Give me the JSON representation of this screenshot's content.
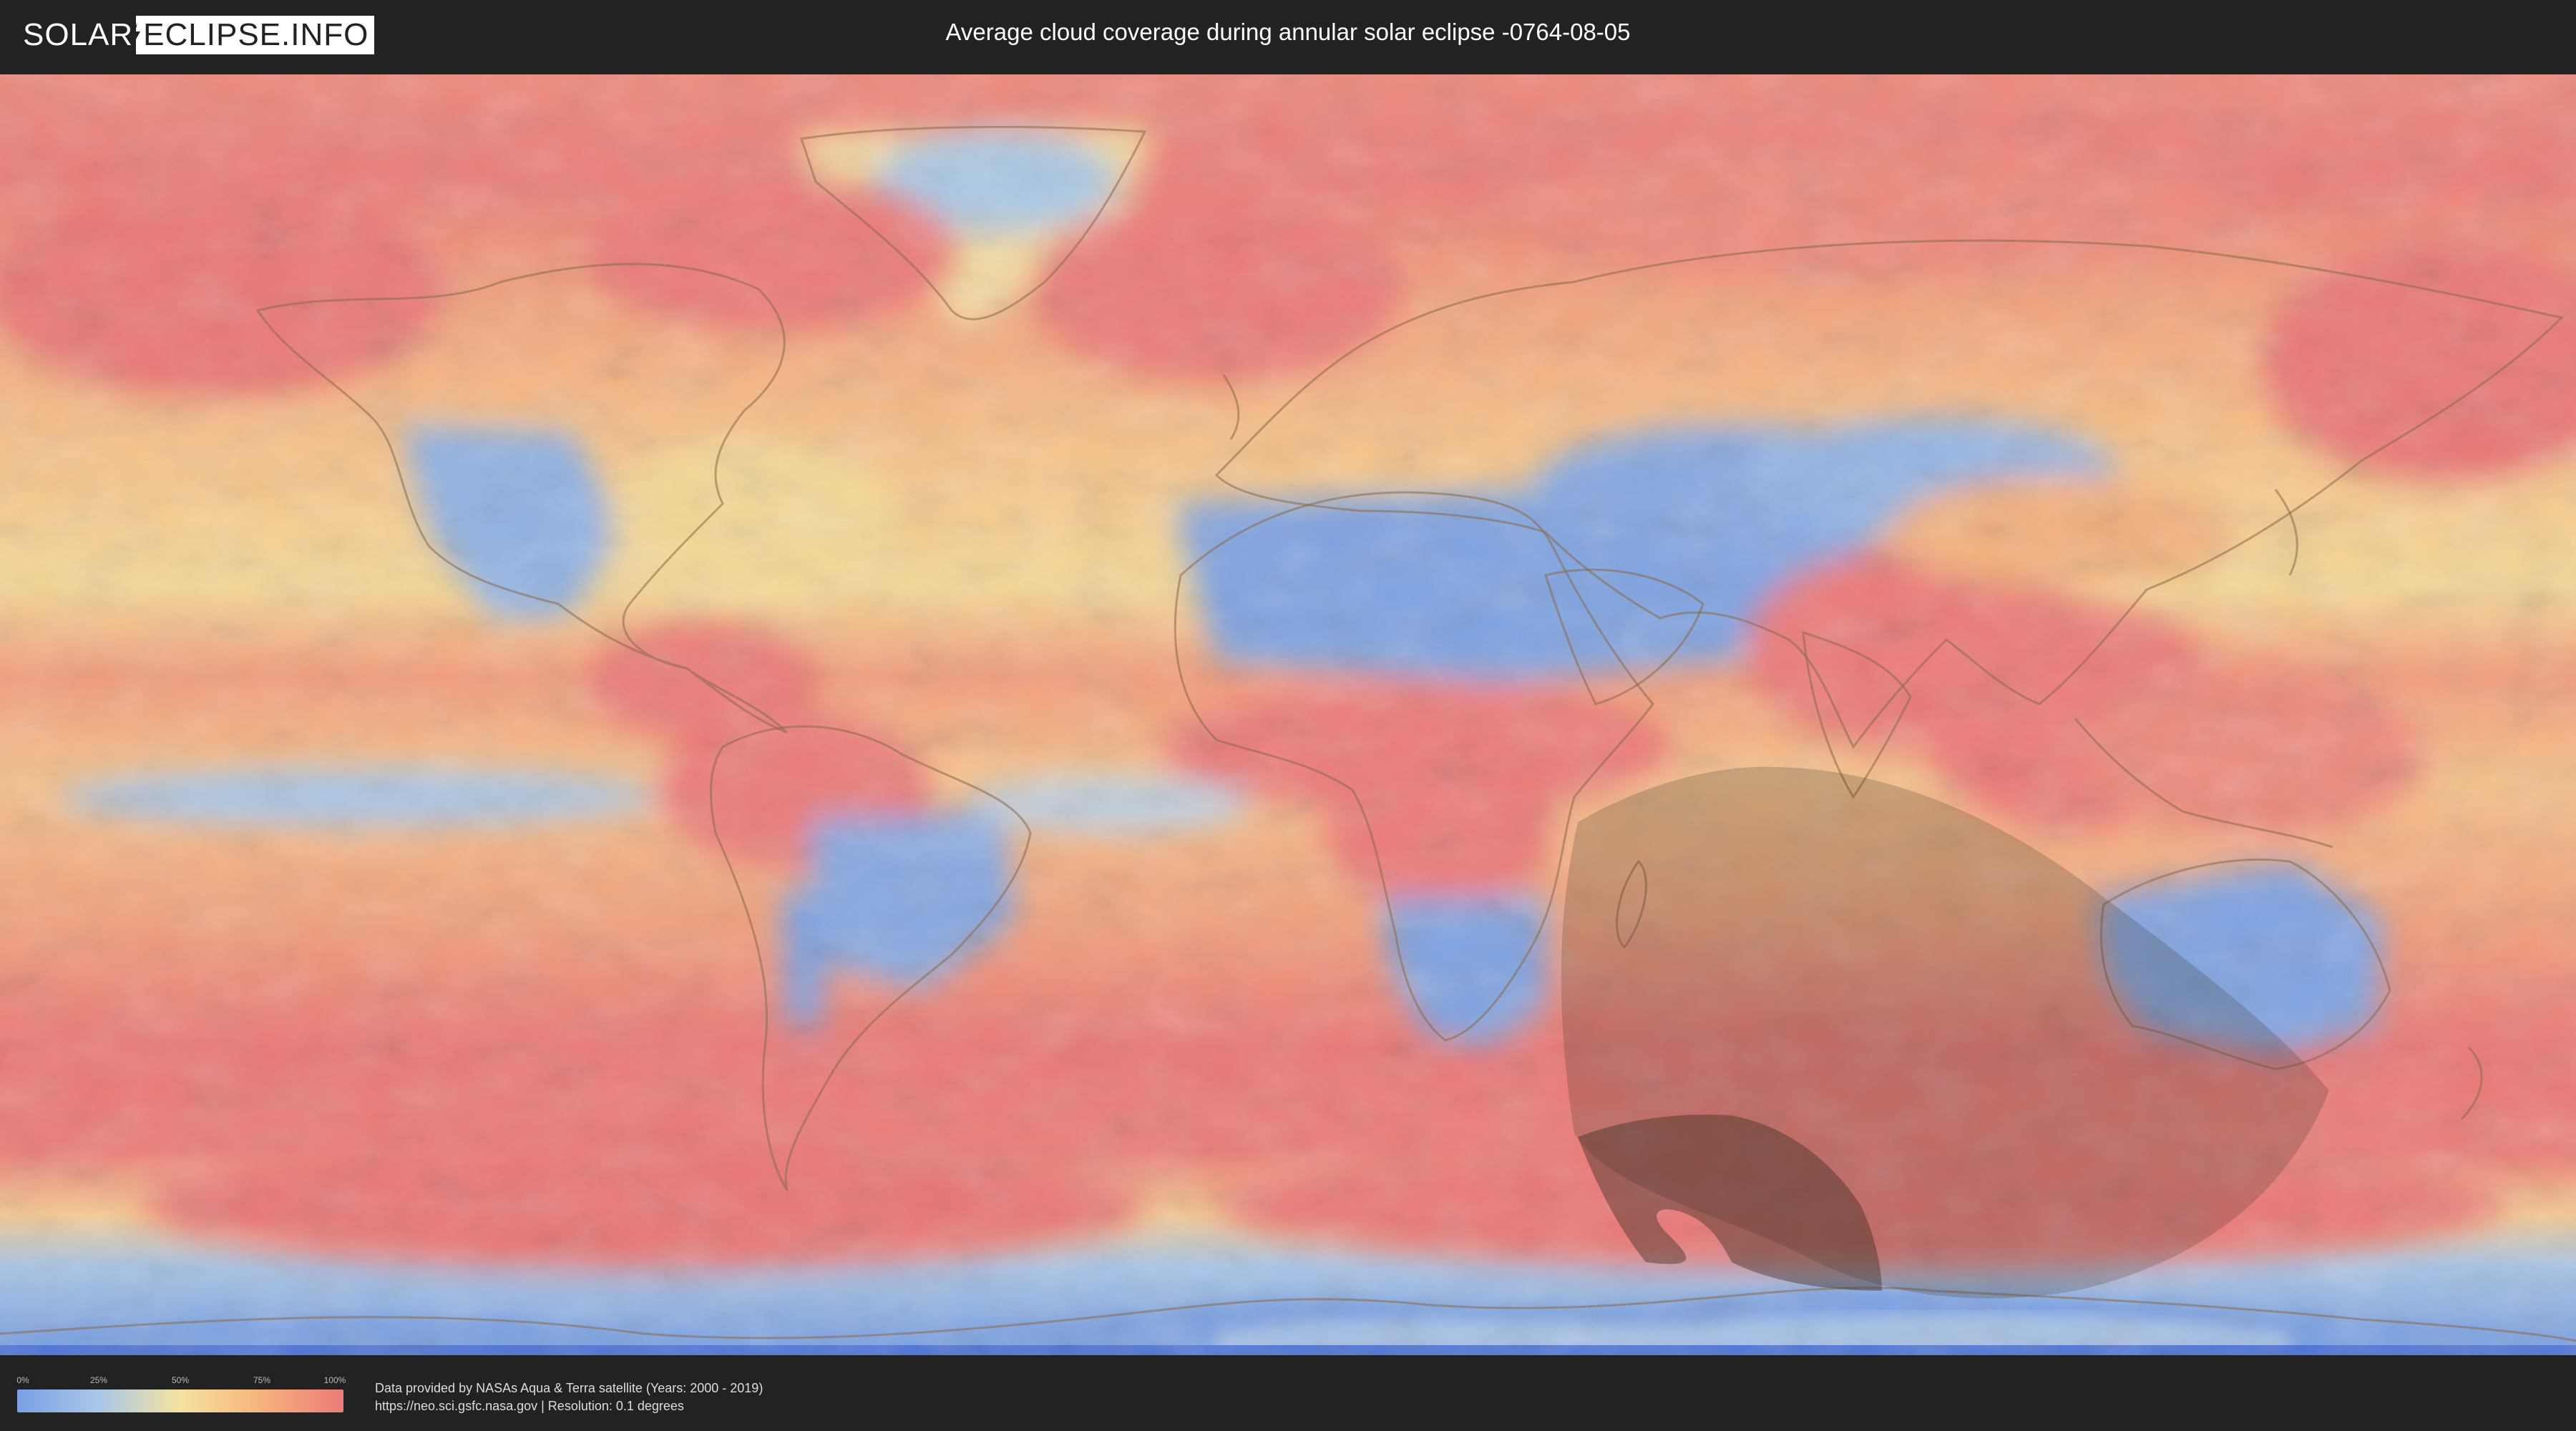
{
  "header": {
    "logo_left": "SOLAR",
    "logo_right": "ECLIPSE.INFO",
    "title": "Average cloud coverage during annular solar eclipse -0764-08-05"
  },
  "map": {
    "eclipse_type": "annular",
    "date": "-0764-08-05",
    "colors": {
      "clear": "#7ba0e0",
      "low": "#a8c8e6",
      "mid": "#f5e3a0",
      "high": "#f6b27c",
      "overcast": "#ec7a78",
      "shadow": "#3c3426"
    }
  },
  "legend": {
    "ticks": [
      "0%",
      "25%",
      "50%",
      "75%",
      "100%"
    ],
    "colors": [
      "#7aa0e4",
      "#a9c7e8",
      "#f5e3a0",
      "#f6b27c",
      "#ec7b79"
    ]
  },
  "footer": {
    "credit_line1": "Data provided by NASAs Aqua & Terra satellite (Years: 2000 - 2019)",
    "credit_line2": "https://neo.sci.gsfc.nasa.gov | Resolution: 0.1 degrees"
  }
}
